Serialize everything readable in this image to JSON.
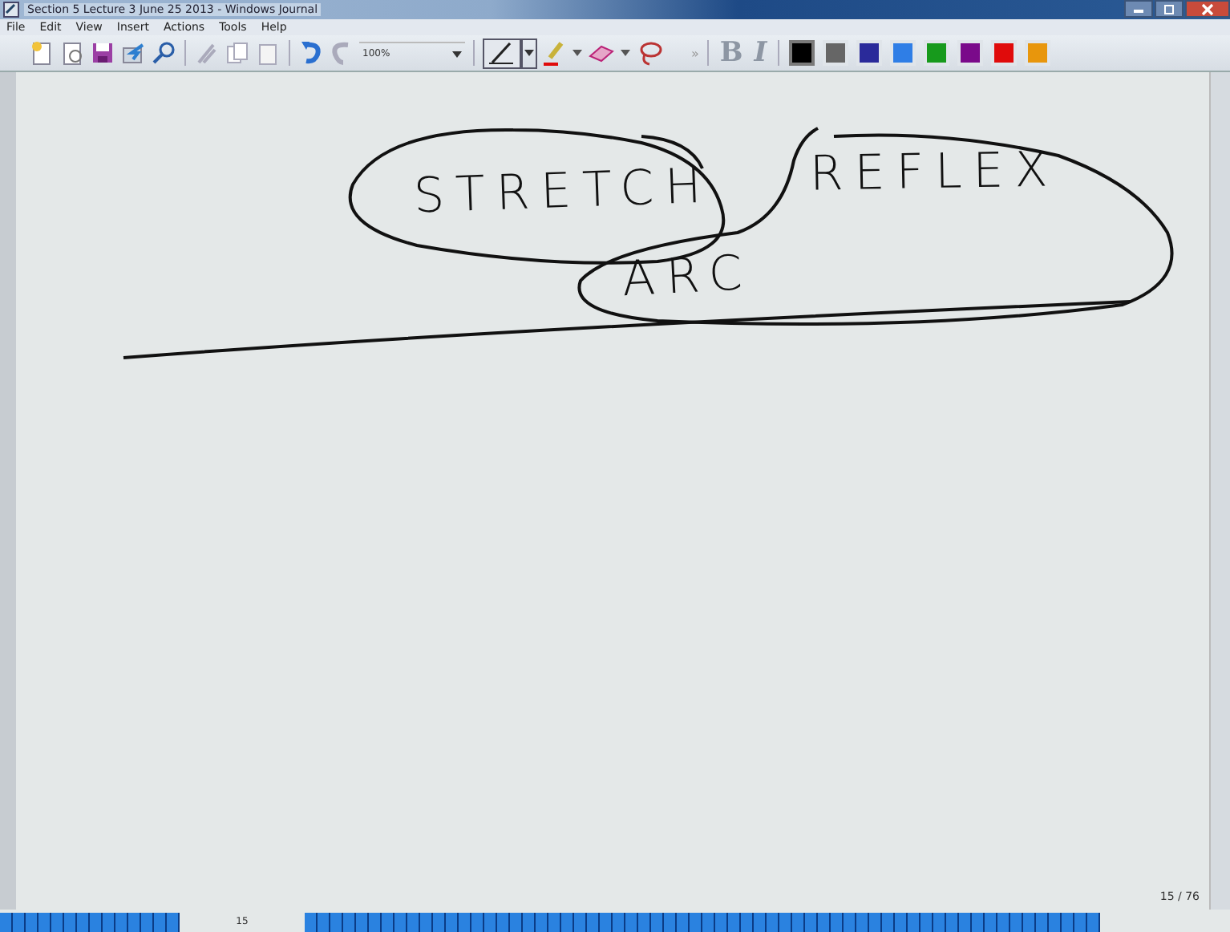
{
  "window": {
    "title": "Section 5 Lecture 3 June 25 2013 - Windows Journal"
  },
  "menu": [
    "File",
    "Edit",
    "View",
    "Insert",
    "Actions",
    "Tools",
    "Help"
  ],
  "toolbar": {
    "zoom": "100%",
    "overflow": "»",
    "bold": "B",
    "italic": "I",
    "colors": [
      {
        "color": "#000000",
        "selected": true
      },
      {
        "color": "#666666",
        "selected": false
      },
      {
        "color": "#2a2a9a",
        "selected": false
      },
      {
        "color": "#2f7ee6",
        "selected": false
      },
      {
        "color": "#179a1c",
        "selected": false
      },
      {
        "color": "#7a0a8a",
        "selected": false
      },
      {
        "color": "#e00b0b",
        "selected": false
      },
      {
        "color": "#e8960c",
        "selected": false
      }
    ]
  },
  "ink": [
    {
      "text": "STRETCH"
    },
    {
      "text": "REFLEX"
    },
    {
      "text": "ARC"
    }
  ],
  "page_counter": "15 / 76",
  "page_bar": {
    "current": "15"
  }
}
